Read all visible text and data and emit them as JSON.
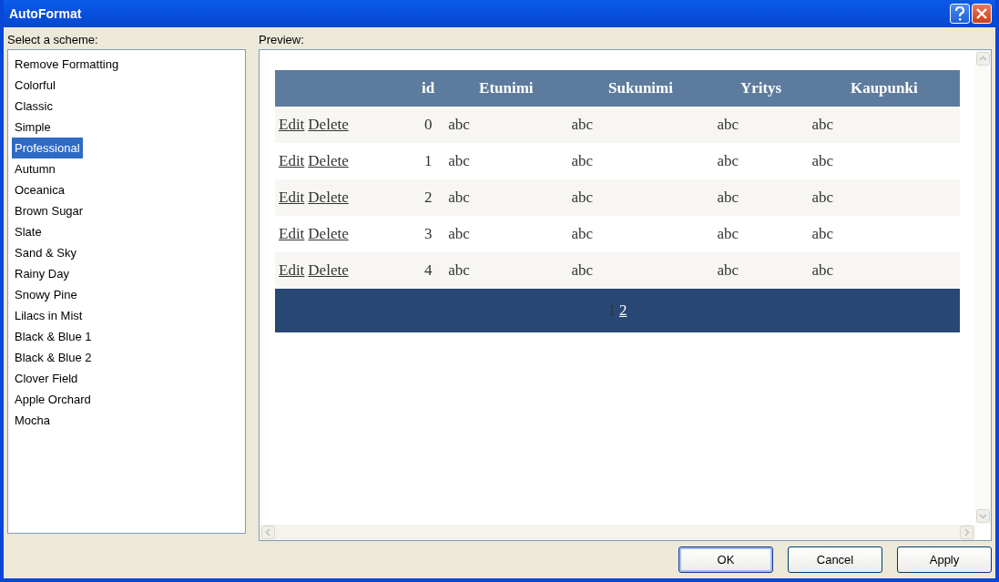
{
  "window": {
    "title": "AutoFormat"
  },
  "schemes": {
    "label": "Select a scheme:",
    "items": [
      {
        "label": "Remove Formatting",
        "selected": false
      },
      {
        "label": "Colorful",
        "selected": false
      },
      {
        "label": "Classic",
        "selected": false
      },
      {
        "label": "Simple",
        "selected": false
      },
      {
        "label": "Professional",
        "selected": true
      },
      {
        "label": "Autumn",
        "selected": false
      },
      {
        "label": "Oceanica",
        "selected": false
      },
      {
        "label": "Brown Sugar",
        "selected": false
      },
      {
        "label": "Slate",
        "selected": false
      },
      {
        "label": "Sand & Sky",
        "selected": false
      },
      {
        "label": "Rainy Day",
        "selected": false
      },
      {
        "label": "Snowy Pine",
        "selected": false
      },
      {
        "label": "Lilacs in Mist",
        "selected": false
      },
      {
        "label": "Black & Blue 1",
        "selected": false
      },
      {
        "label": "Black & Blue 2",
        "selected": false
      },
      {
        "label": "Clover Field",
        "selected": false
      },
      {
        "label": "Apple Orchard",
        "selected": false
      },
      {
        "label": "Mocha",
        "selected": false
      }
    ]
  },
  "preview": {
    "label": "Preview:",
    "table": {
      "columns": [
        "id",
        "Etunimi",
        "Sukunimi",
        "Yritys",
        "Kaupunki"
      ],
      "rows": [
        {
          "actions": [
            "Edit",
            "Delete"
          ],
          "cells": [
            "0",
            "abc",
            "abc",
            "abc",
            "abc"
          ]
        },
        {
          "actions": [
            "Edit",
            "Delete"
          ],
          "cells": [
            "1",
            "abc",
            "abc",
            "abc",
            "abc"
          ]
        },
        {
          "actions": [
            "Edit",
            "Delete"
          ],
          "cells": [
            "2",
            "abc",
            "abc",
            "abc",
            "abc"
          ]
        },
        {
          "actions": [
            "Edit",
            "Delete"
          ],
          "cells": [
            "3",
            "abc",
            "abc",
            "abc",
            "abc"
          ]
        },
        {
          "actions": [
            "Edit",
            "Delete"
          ],
          "cells": [
            "4",
            "abc",
            "abc",
            "abc",
            "abc"
          ]
        }
      ],
      "pages": [
        {
          "label": "1",
          "selected": true
        },
        {
          "label": "2",
          "selected": false
        }
      ]
    }
  },
  "buttons": [
    {
      "label": "OK",
      "default": true
    },
    {
      "label": "Cancel",
      "default": false
    },
    {
      "label": "Apply",
      "default": false
    }
  ]
}
